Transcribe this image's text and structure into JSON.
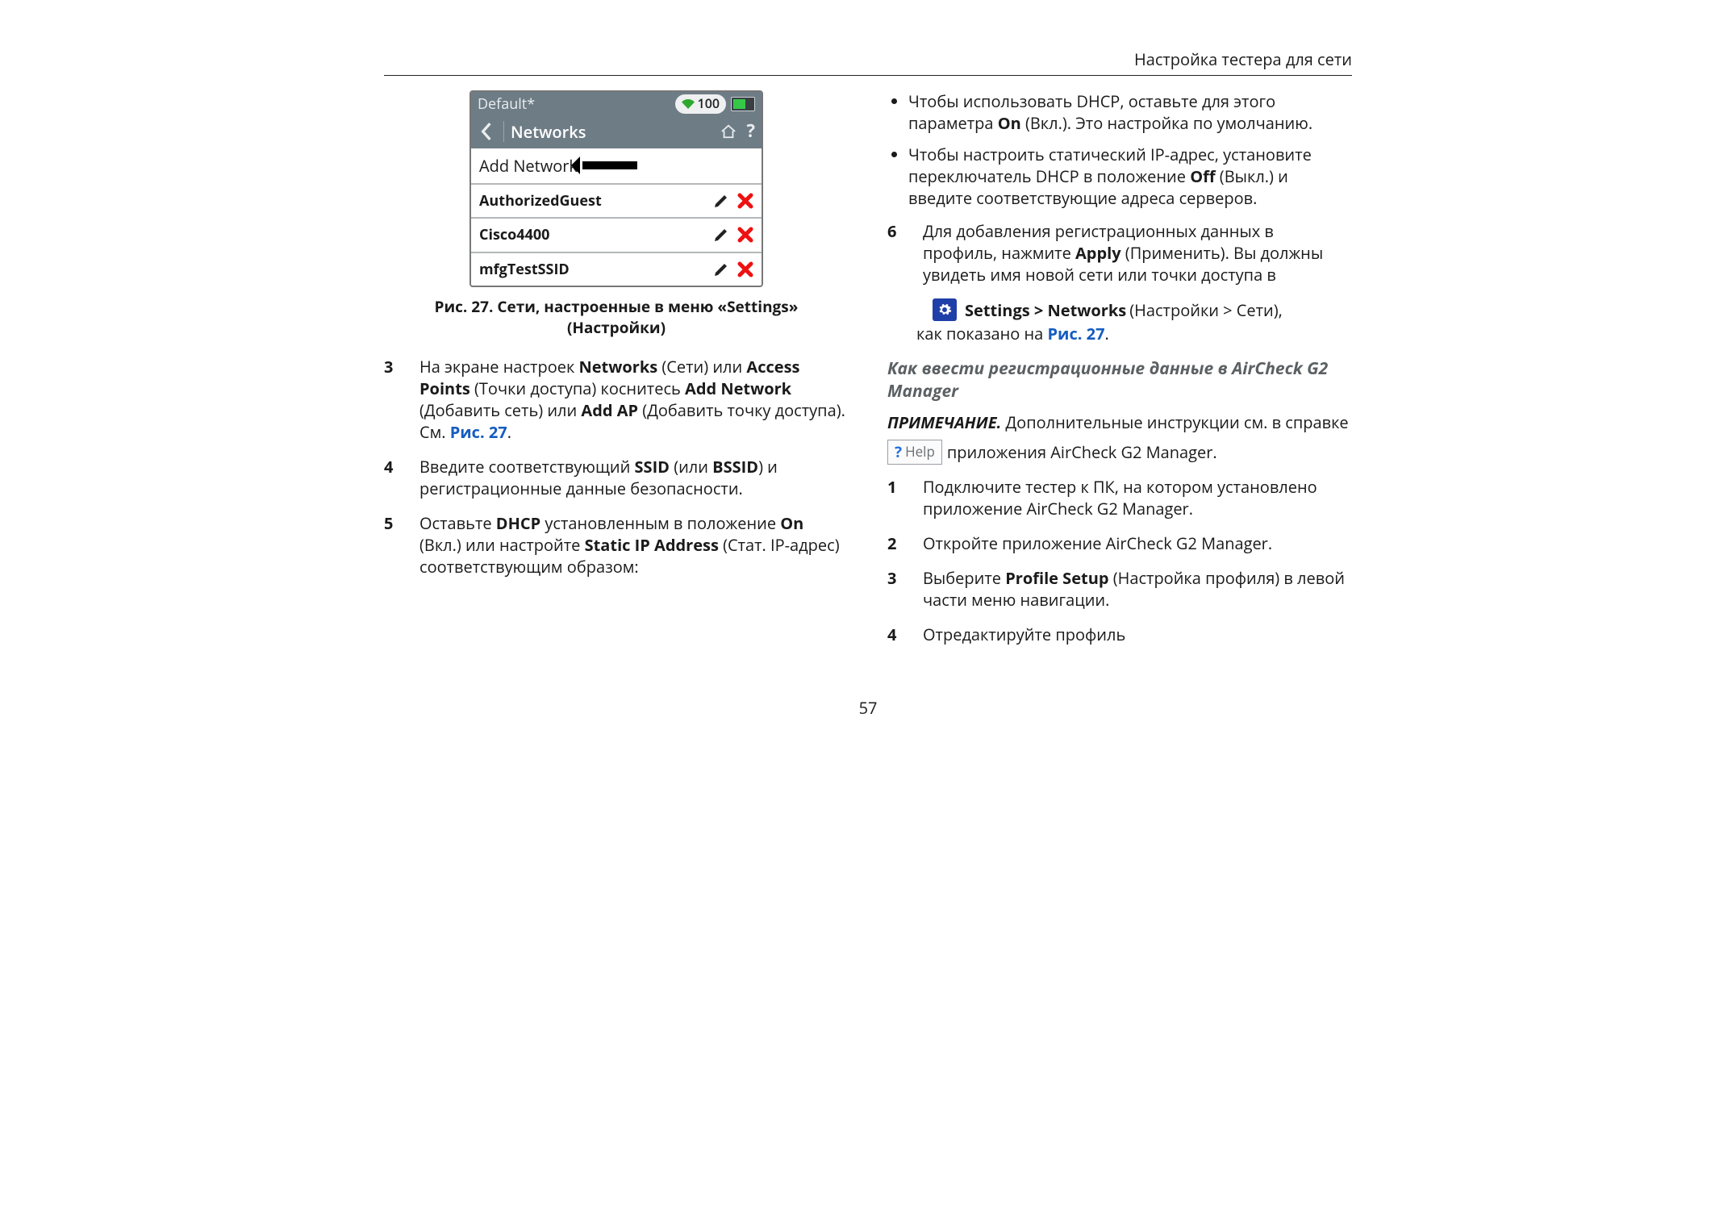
{
  "header": {
    "title": "Настройка тестера для сети"
  },
  "device": {
    "status_title": "Default*",
    "wifi_value": "100",
    "nav_title": "Networks",
    "rows": [
      {
        "label": "Add Network",
        "type": "add"
      },
      {
        "label": "AuthorizedGuest",
        "type": "ssid"
      },
      {
        "label": "Cisco4400",
        "type": "ssid"
      },
      {
        "label": "mfgTestSSID",
        "type": "ssid"
      }
    ]
  },
  "figure_caption": "Рис. 27. Сети, настроенные в меню «Settings» (Настройки)",
  "left_steps": {
    "s3": {
      "num": "3",
      "t1": "На экране настроек ",
      "b1": "Networks",
      "t2": " (Сети) или ",
      "b2": "Access Points",
      "t3": " (Точки доступа) коснитесь ",
      "b3": "Add Network",
      "t4": " (Добавить сеть) или ",
      "b4": "Add AP",
      "t5": " (Добавить точку доступа). См. ",
      "ref": "Рис. 27",
      "t6": "."
    },
    "s4": {
      "num": "4",
      "t1": "Введите соответствующий ",
      "b1": "SSID",
      "t2": " (или ",
      "b2": "BSSID",
      "t3": ") и регистрационные данные безопасности."
    },
    "s5": {
      "num": "5",
      "t1": "Оставьте ",
      "b1": "DHCP",
      "t2": " установленным в положение ",
      "b2": "On",
      "t3": " (Вкл.) или настройте ",
      "b3": "Static IP Address",
      "t4": " (Стат. IP-адрес) соответствующим образом:"
    }
  },
  "right": {
    "bul1": {
      "t1": "Чтобы использовать DHCP, оставьте для этого параметра ",
      "b1": "On",
      "t2": " (Вкл.). Это настройка по умолчанию."
    },
    "bul2": {
      "t1": "Чтобы настроить статический IP-адрес, установите переключатель DHCP в положение ",
      "b1": "Off",
      "t2": " (Выкл.) и введите соответствующие адреса серверов."
    },
    "s6": {
      "num": "6",
      "t1": "Для добавления регистрационных данных в профиль, нажмите ",
      "b1": "Apply",
      "t2": " (Применить). Вы должны увидеть имя новой сети или точки доступа в"
    },
    "settings_path": {
      "b1": "Settings > Networks",
      "t1": " (Настройки > Сети),"
    },
    "settings_tail": {
      "t1": "как показано на ",
      "ref": "Рис. 27",
      "t2": "."
    },
    "subheading": "Как ввести регистрационные данные в AirCheck G2 Manager",
    "note": {
      "label": "ПРИМЕЧАНИЕ.",
      "t1": " Дополнительные инструкции см. в справке"
    },
    "help_line": {
      "help_label": "Help",
      "t1": " приложения AirCheck G2 Manager."
    },
    "r1": {
      "num": "1",
      "text": "Подключите тестер к ПК, на котором установлено приложение AirCheck G2 Manager."
    },
    "r2": {
      "num": "2",
      "text": "Откройте приложение AirCheck G2 Manager."
    },
    "r3": {
      "num": "3",
      "t1": "Выберите ",
      "b1": "Profile Setup",
      "t2": " (Настройка профиля) в левой части меню навигации."
    },
    "r4": {
      "num": "4",
      "text": "Отредактируйте профиль"
    }
  },
  "page_number": "57"
}
